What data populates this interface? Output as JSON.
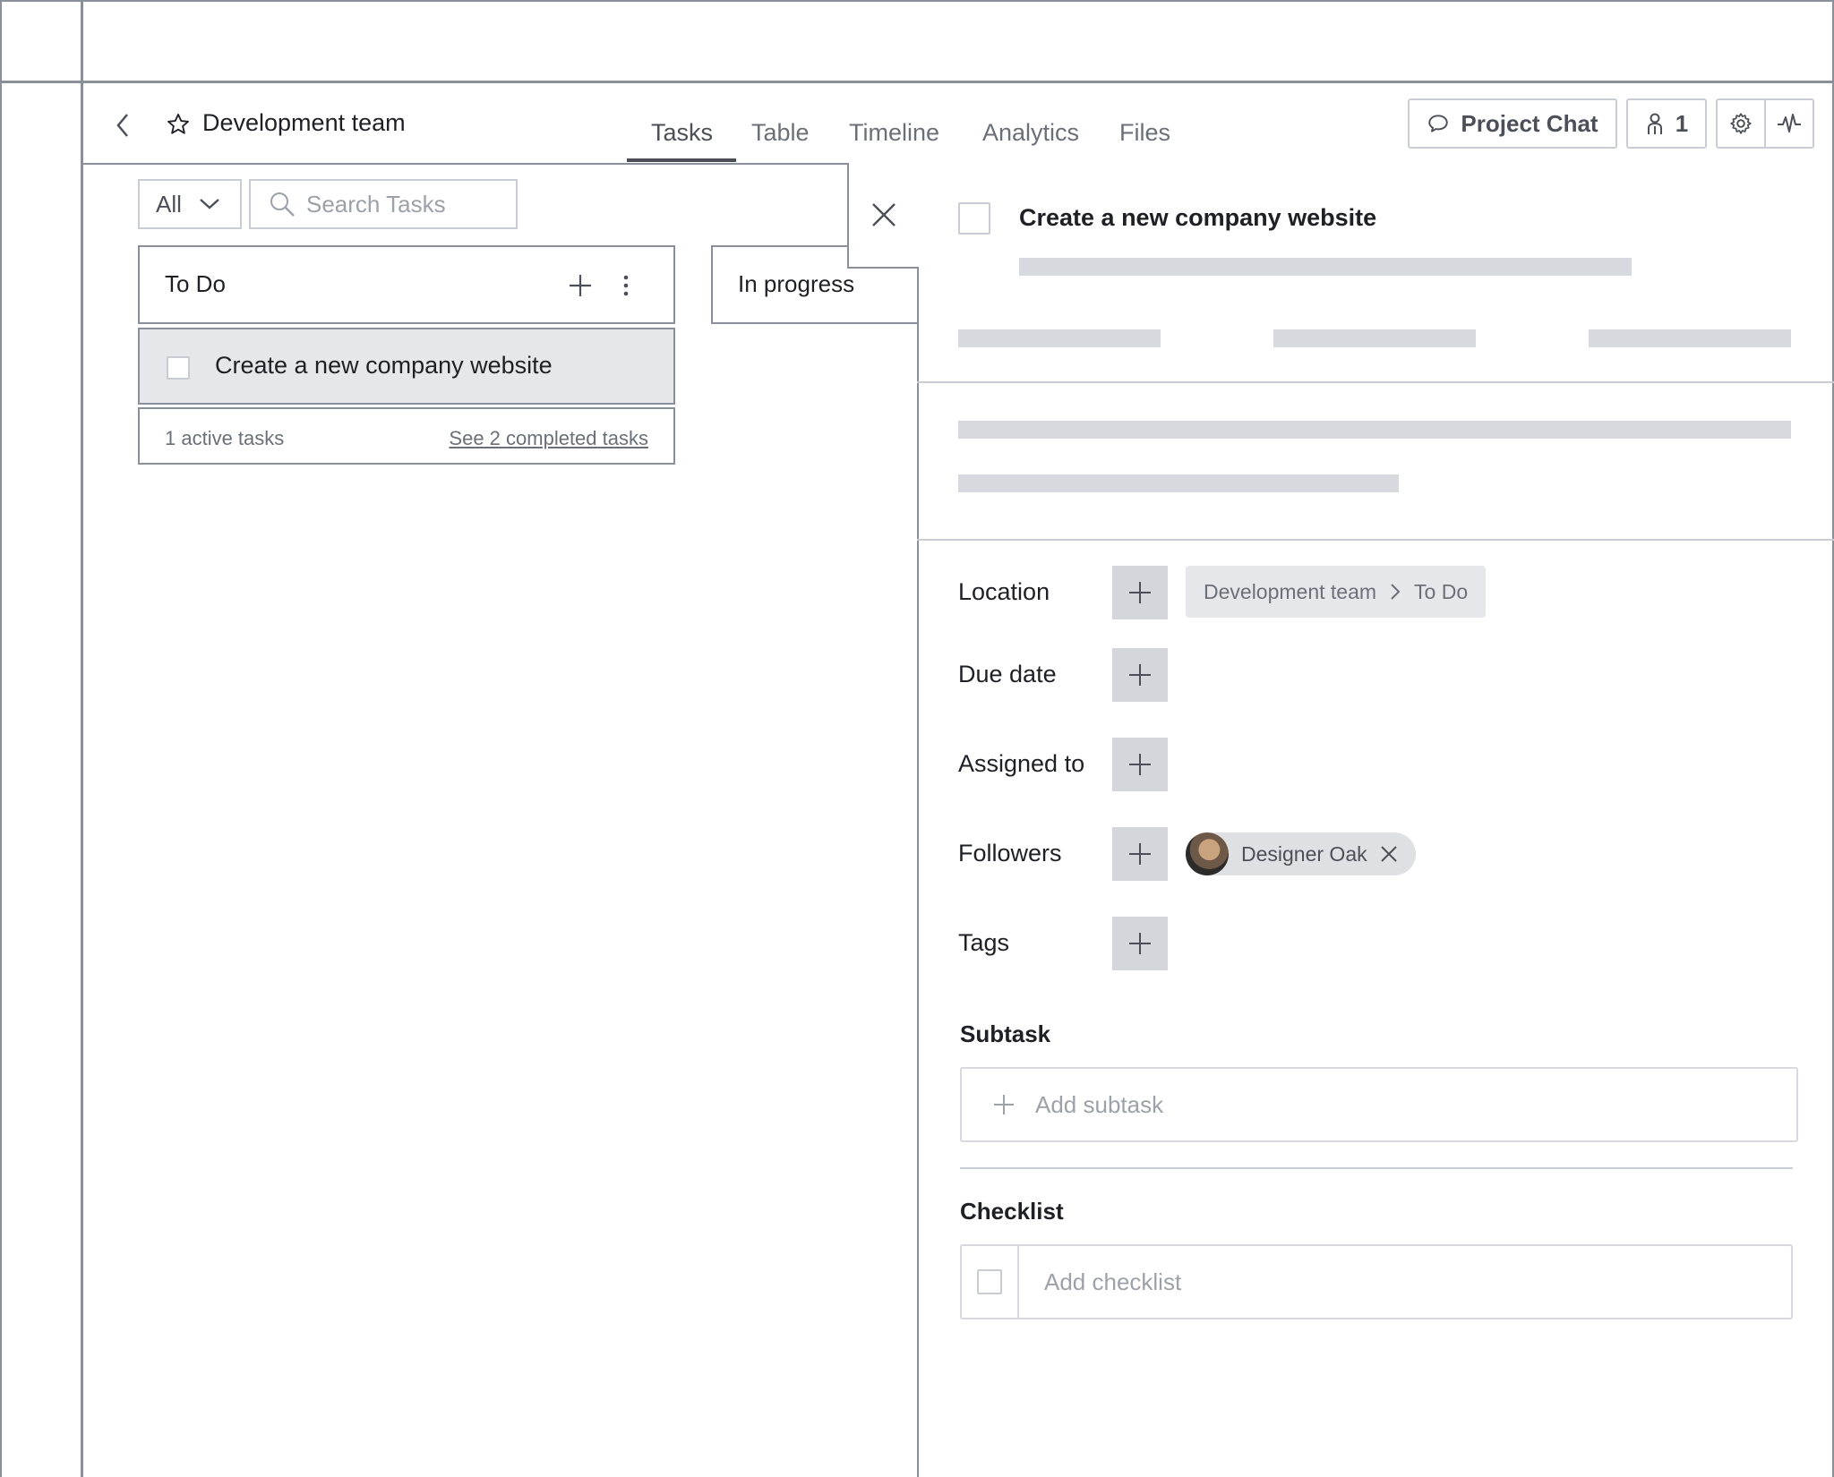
{
  "header": {
    "project_title": "Development team",
    "tabs": [
      {
        "label": "Tasks",
        "active": true
      },
      {
        "label": "Table",
        "active": false
      },
      {
        "label": "Timeline",
        "active": false
      },
      {
        "label": "Analytics",
        "active": false
      },
      {
        "label": "Files",
        "active": false
      }
    ],
    "project_chat_label": "Project Chat",
    "members_count": "1"
  },
  "board": {
    "filter_value": "All",
    "search_placeholder": "Search Tasks",
    "columns": [
      {
        "title": "To Do"
      },
      {
        "title": "In progress"
      }
    ],
    "card_title": "Create a new company website",
    "active_tasks": "1 active tasks",
    "completed_link": "See 2 completed tasks"
  },
  "detail": {
    "task_title": "Create a new company website",
    "fields": {
      "location": "Location",
      "due_date": "Due date",
      "assigned_to": "Assigned to",
      "followers": "Followers",
      "tags": "Tags"
    },
    "location_path": {
      "project": "Development team",
      "column": "To Do"
    },
    "follower_name": "Designer Oak",
    "subtask_title": "Subtask",
    "add_subtask_placeholder": "Add subtask",
    "checklist_title": "Checklist",
    "add_checklist_placeholder": "Add checklist"
  },
  "colors": {
    "border": "#8a8f99",
    "muted_text": "#6b6f78",
    "skeleton": "#d8d9de",
    "plus_box": "#d4d6db",
    "card_bg": "#e6e7eb"
  }
}
